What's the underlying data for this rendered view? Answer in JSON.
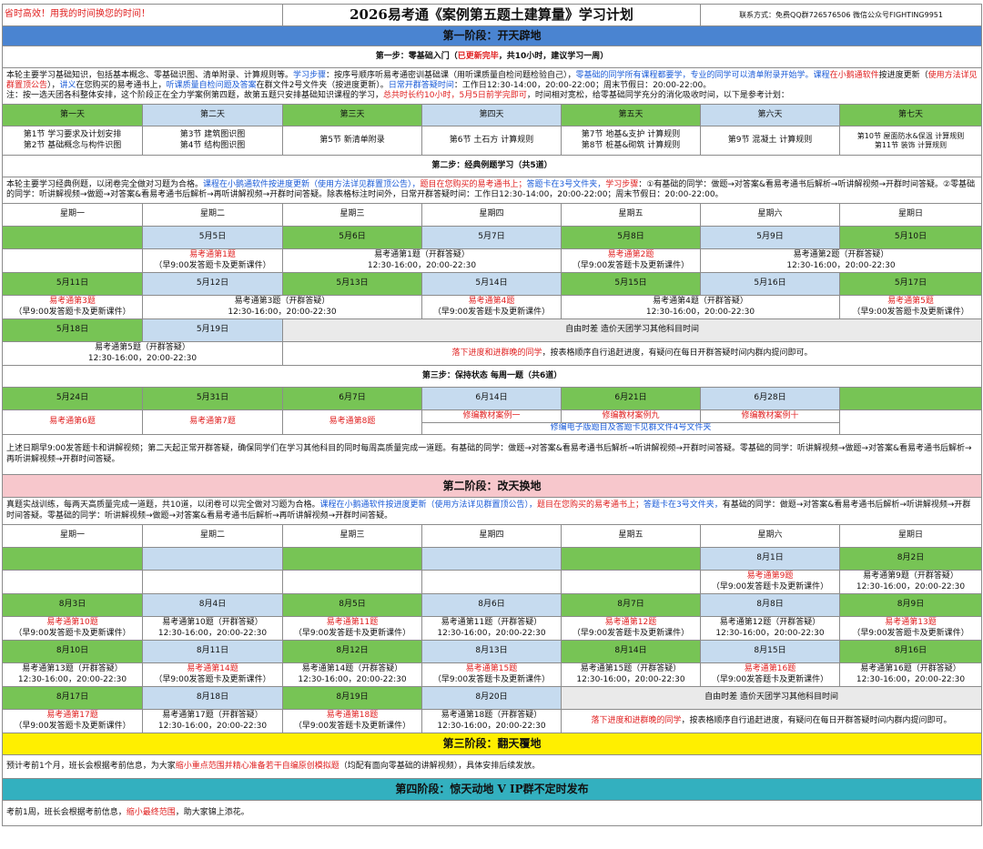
{
  "header": {
    "slogan": "省时高效！用我的时间换您的时间！",
    "title": "2026易考通《案例第五题土建算量》学习计划",
    "contact": "联系方式：免费QQ群726576506  微信公众号FIGHTING9951"
  },
  "stage1": {
    "title": "第一阶段：开天辟地",
    "step1": {
      "a": "第一步：零基础入门（",
      "b": "已更新完毕",
      "c": "，共10小时，建议学习一周）"
    },
    "desc": {
      "t1": "本轮主要学习基础知识，包括基本概念、零基础识图、清单附录、计算规则等。",
      "t2": "学习步骤",
      "t3": "：按序号顺序听易考通密训基础课（用听课质量自检问题检验自己），",
      "t4": "零基础的同学所有课程都要学，专业的同学可以清单附录开始学。",
      "t5": "课程",
      "t6": "在小鹅通软件",
      "t7": "按进度更新（",
      "t8": "使用方法详见群置顶公告",
      "t9": "），",
      "t10": "讲义",
      "t11": "在您购买的易考通书上，",
      "t12": "听课质量自检问题及答案",
      "t13": "在群文件2号文件夹（按进度更新）。",
      "t14": "日常开群答疑时间",
      "t15": "：工作日12:30-14:00，20:00-22:00；周末节假日：20:00-22:00。",
      "t16": "注：按一选天团各科整体安排，这个阶段正在全力学案例第四题，故第五题只安排基础知识课程的学习，",
      "t17": "总共时长约10小时，5月5日前学完即可",
      "t18": "，时间相对宽松，给零基础同学充分的消化吸收时间，以下是参考计划："
    },
    "days": [
      "第一天",
      "第二天",
      "第三天",
      "第四天",
      "第五天",
      "第六天",
      "第七天"
    ],
    "lessons": [
      [
        "第1节 学习要求及计划安排",
        "第2节 基础概念与构件识图"
      ],
      [
        "第3节 建筑图识图",
        "第4节 结构图识图"
      ],
      [
        "第5节 新清单附录"
      ],
      [
        "第6节 土石方 计算规则"
      ],
      [
        "第7节 地基&支护 计算规则",
        "第8节 桩基&砌筑 计算规则"
      ],
      [
        "第9节 混凝土 计算规则"
      ],
      [
        "第10节 屋面防水&保温 计算规则",
        "第11节  装饰 计算规则"
      ]
    ],
    "step2": "第二步：经典例题学习（共5道）",
    "desc2": {
      "t1": "本轮主要学习经典例题，以闭卷完全做对习题为合格。",
      "t2": "课程在小鹅通软件按进度更新（使用方法详见群置顶公告），",
      "t3": "题目在您购买的易考通书上；",
      "t4": "答题卡在3号文件夹，",
      "t5": "学习步骤",
      "t6": "：①有基础的同学：做题→对答案&看易考通书后解析→听讲解视频→开群时间答疑。②零基础的同学：听讲解视频→做题→对答案&看易考通书后解析→再听讲解视频→开群时间答疑。除表格标注时间外，日常开群答疑时间：工作日12:30-14:00，20:00-22:00；周末节假日：20:00-22:00。"
    },
    "weekdays": [
      "星期一",
      "星期二",
      "星期三",
      "星期四",
      "星期五",
      "星期六",
      "星期日"
    ],
    "w1": {
      "d": [
        "5月5日",
        "5月6日",
        "5月7日",
        "5月8日",
        "5月9日",
        "5月10日"
      ],
      "q1": "易考通第1题",
      "q1s": "（早9:00发答题卡及更新课件）",
      "a1": "易考通第1题（开群答疑）",
      "a1s": "12:30-16:00，20:00-22:30",
      "q2": "易考通第2题",
      "q2s": "（早9:00发答题卡及更新课件）",
      "a2": "易考通第2题（开群答疑）",
      "a2s": "12:30-16:00，20:00-22:30"
    },
    "w2": {
      "d": [
        "5月11日",
        "5月12日",
        "5月13日",
        "5月14日",
        "5月15日",
        "5月16日",
        "5月17日"
      ],
      "q3": "易考通第3题",
      "q3s": "（早9:00发答题卡及更新课件）",
      "a3": "易考通第3题（开群答疑）",
      "a3s": "12:30-16:00，20:00-22:30",
      "q4": "易考通第4题",
      "q4s": "（早9:00发答题卡及更新课件）",
      "a4": "易考通第4题（开群答疑）",
      "a4s": "12:30-16:00，20:00-22:30",
      "q5": "易考通第5题",
      "q5s": "（早9:00发答题卡及更新课件）"
    },
    "w3": {
      "d": [
        "5月18日",
        "5月19日"
      ],
      "free": "自由时差  造价天团学习其他科目时间",
      "a5": "易考通第5题（开群答疑）",
      "a5s": "12:30-16:00，20:00-22:30",
      "late1": "落下进度和进群晚的同学",
      "late2": "，按表格顺序自行追赶进度，有疑问在每日开群答疑时间内群内提问即可。"
    },
    "step3": "第三步：保持状态 每周一题（共6道）",
    "w4": {
      "d": [
        "5月24日",
        "5月31日",
        "6月7日",
        "6月14日",
        "6月21日",
        "6月28日"
      ],
      "q": [
        "易考通第6题",
        "易考通第7题",
        "易考通第8题",
        "修编教材案例一",
        "修编教材案例九",
        "修编教材案例十"
      ],
      "note": "修编电子版题目及答题卡见群文件4号文件夹"
    },
    "foot": "上述日期早9:00发答题卡和讲解视频；第二天起正常开群答疑，确保同学们在学习其他科目的同时每周高质量完成一道题。有基础的同学：做题→对答案&看易考通书后解析→听讲解视频→开群时间答疑。零基础的同学：听讲解视频→做题→对答案&看易考通书后解析→再听讲解视频→开群时间答疑。"
  },
  "stage2": {
    "title": "第二阶段：改天换地",
    "desc": {
      "t1": "真题实战训练，每两天高质量完成一道题，共10道，以闭卷可以完全做对习题为合格。",
      "t2": "课程在小鹅通软件按进度更新（使用方法详见群置顶公告），",
      "t3": "题目在您购买的易考通书上；",
      "t4": "答题卡在3号文件夹，",
      "t5": "有基础的同学：做题→对答案&看易考通书后解析→听讲解视频→开群时间答疑。零基础的同学：听讲解视频→做题→对答案&看易考通书后解析→再听讲解视频→开群时间答疑。"
    },
    "weekdays": [
      "星期一",
      "星期二",
      "星期三",
      "星期四",
      "星期五",
      "星期六",
      "星期日"
    ],
    "wa": {
      "d": [
        "8月1日",
        "8月2日"
      ],
      "q9": "易考通第9题",
      "q9s": "（早9:00发答题卡及更新课件）",
      "a9": "易考通第9题（开群答疑）",
      "a9s": "12:30-16:00，20:00-22:30"
    },
    "wb": {
      "d": [
        "8月3日",
        "8月4日",
        "8月5日",
        "8月6日",
        "8月7日",
        "8月8日",
        "8月9日"
      ],
      "c": [
        [
          "q",
          "易考通第10题"
        ],
        [
          "a",
          "易考通第10题（开群答疑）"
        ],
        [
          "q",
          "易考通第11题"
        ],
        [
          "a",
          "易考通第11题（开群答疑）"
        ],
        [
          "q",
          "易考通第12题"
        ],
        [
          "a",
          "易考通第12题（开群答疑）"
        ],
        [
          "q",
          "易考通第13题"
        ]
      ]
    },
    "wc": {
      "d": [
        "8月10日",
        "8月11日",
        "8月12日",
        "8月13日",
        "8月14日",
        "8月15日",
        "8月16日"
      ],
      "c": [
        [
          "a",
          "易考通第13题（开群答疑）"
        ],
        [
          "q",
          "易考通第14题"
        ],
        [
          "a",
          "易考通第14题（开群答疑）"
        ],
        [
          "q",
          "易考通第15题"
        ],
        [
          "a",
          "易考通第15题（开群答疑）"
        ],
        [
          "q",
          "易考通第16题"
        ],
        [
          "a",
          "易考通第16题（开群答疑）"
        ]
      ]
    },
    "wd": {
      "d": [
        "8月17日",
        "8月18日",
        "8月19日",
        "8月20日"
      ],
      "c": [
        [
          "q",
          "易考通第17题"
        ],
        [
          "a",
          "易考通第17题（开群答疑）"
        ],
        [
          "q",
          "易考通第18题"
        ],
        [
          "a",
          "易考通第18题（开群答疑）"
        ]
      ],
      "free": "自由时差  造价天团学习其他科目时间",
      "late1": "落下进度和进群晚的同学",
      "late2": "，按表格顺序自行追赶进度，有疑问在每日开群答疑时间内群内提问即可。"
    },
    "qsub": "（早9:00发答题卡及更新课件）",
    "asub": "12:30-16:00，20:00-22:30"
  },
  "stage3": {
    "title": "第三阶段：翻天覆地",
    "t1": "预计考前1个月，班长会根据考前信息，为大家",
    "t2": "缩小重点范围并精心准备若干自编原创模拟题",
    "t3": "（均配有面向零基础的讲解视频），具体安排后续发放。"
  },
  "stage4": {
    "title": "第四阶段：惊天动地 V IP群不定时发布",
    "t1": "考前1周，班长会根据考前信息，",
    "t2": "缩小最终范围",
    "t3": "，助大家锦上添花。"
  }
}
